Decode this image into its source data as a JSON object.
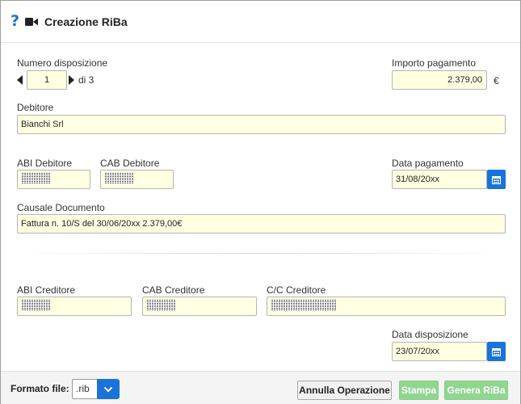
{
  "header": {
    "title": "Creazione RiBa",
    "help_glyph": "?"
  },
  "numero": {
    "label": "Numero disposizione",
    "value": "1",
    "of_text": "di 3"
  },
  "importo": {
    "label": "Importo pagamento",
    "value": "2.379,00",
    "currency": "€"
  },
  "debitore": {
    "label": "Debitore",
    "value": "Bianchi Srl"
  },
  "abi_debitore": {
    "label": "ABI Debitore"
  },
  "cab_debitore": {
    "label": "CAB Debitore"
  },
  "data_pagamento": {
    "label": "Data pagamento",
    "value": "31/08/20xx"
  },
  "causale": {
    "label": "Causale Documento",
    "value": "Fattura n. 10/S del 30/06/20xx 2.379,00€"
  },
  "abi_creditore": {
    "label": "ABI Creditore"
  },
  "cab_creditore": {
    "label": "CAB Creditore"
  },
  "cc_creditore": {
    "label": "C/C Creditore"
  },
  "data_disposizione": {
    "label": "Data disposizione",
    "value": "23/07/20xx"
  },
  "footer": {
    "format_label": "Formato file:",
    "format_value": ".rib",
    "cancel_label": "Annulla Operazione",
    "print_label": "Stampa",
    "generate_label": "Genera RiBa"
  },
  "colors": {
    "accent": "#1a73d9",
    "field_bg": "#ffffe1",
    "disabled_green": "#8fd68f"
  },
  "icons": [
    "help-icon",
    "video-camera-icon",
    "calendar-icon",
    "chevron-down-icon",
    "arrow-left-icon",
    "arrow-right-icon"
  ]
}
